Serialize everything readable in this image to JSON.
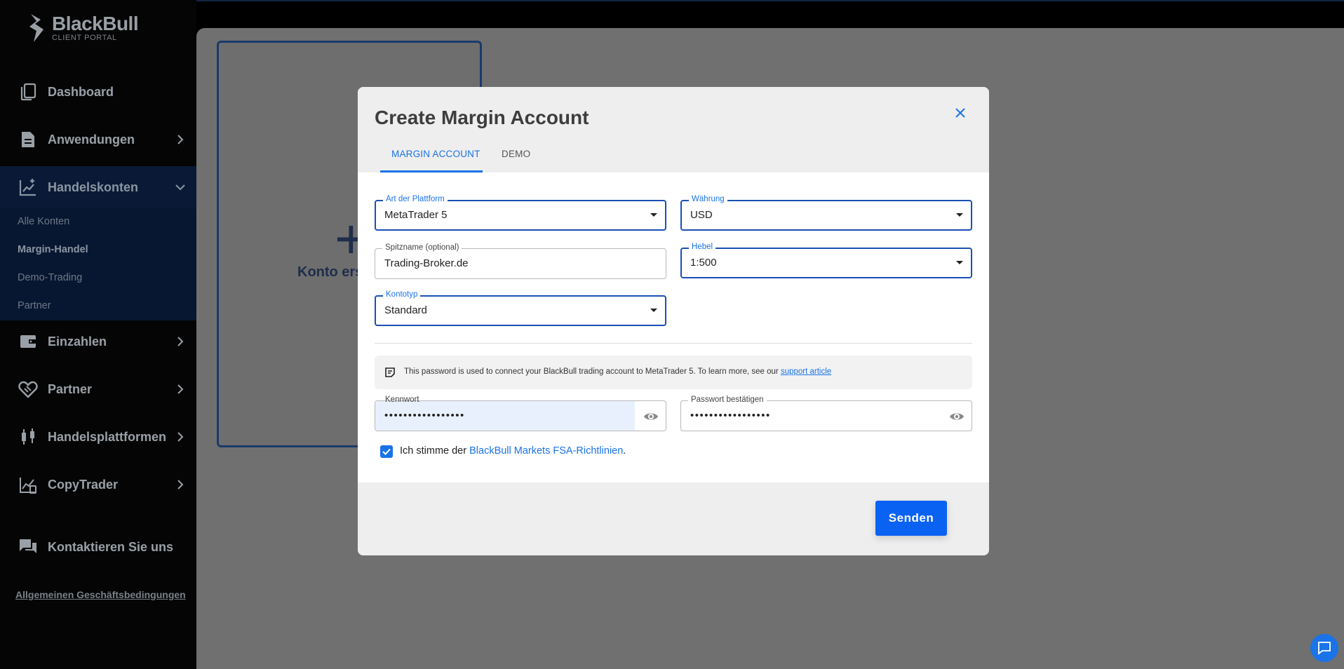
{
  "brand": {
    "name": "BlackBull",
    "subtitle": "CLIENT PORTAL"
  },
  "sidebar": {
    "items": [
      {
        "label": "Dashboard",
        "icon": "copy-icon"
      },
      {
        "label": "Anwendungen",
        "icon": "document-icon"
      },
      {
        "label": "Handelskonten",
        "icon": "chart-plus-icon"
      },
      {
        "label": "Einzahlen",
        "icon": "wallet-icon"
      },
      {
        "label": "Partner",
        "icon": "handshake-icon"
      },
      {
        "label": "Handelsplattformen",
        "icon": "candlestick-icon"
      },
      {
        "label": "CopyTrader",
        "icon": "trend-icon"
      },
      {
        "label": "Kontaktieren Sie uns",
        "icon": "chat-icon"
      }
    ],
    "submenu": [
      "Alle Konten",
      "Margin-Handel",
      "Demo-Trading",
      "Partner"
    ],
    "terms": "Allgemeinen Geschäftsbedingungen"
  },
  "background_card": {
    "plus": "+",
    "label": "Konto ers"
  },
  "modal": {
    "title": "Create Margin Account",
    "tabs": [
      "MARGIN ACCOUNT",
      "DEMO"
    ],
    "fields": {
      "platform": {
        "label": "Art der Plattform",
        "value": "MetaTrader 5"
      },
      "currency": {
        "label": "Währung",
        "value": "USD"
      },
      "nickname": {
        "label": "Spitzname (optional)",
        "value": "Trading-Broker.de"
      },
      "leverage": {
        "label": "Hebel",
        "value": "1:500"
      },
      "account_type": {
        "label": "Kontotyp",
        "value": "Standard"
      },
      "password": {
        "label": "Kennwort",
        "value": "•••••••••••••••••"
      },
      "confirm_password": {
        "label": "Passwort bestätigen",
        "value": "•••••••••••••••••"
      }
    },
    "info": {
      "text": "This password is used to connect your BlackBull trading account to MetaTrader 5. To learn more, see our ",
      "link": "support article"
    },
    "agree": {
      "prefix": "Ich stimme der ",
      "link": "BlackBull Markets FSA-Richtlinien",
      "suffix": "."
    },
    "submit": "Senden"
  },
  "colors": {
    "accent": "#1a73e8",
    "button": "#0a62f2",
    "overlay": "#707070"
  }
}
